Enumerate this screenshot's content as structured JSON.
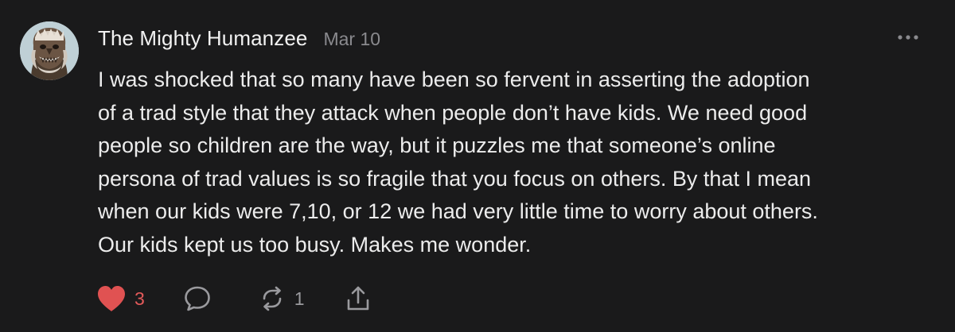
{
  "post": {
    "author": "The Mighty Humanzee",
    "date": "Mar 10",
    "avatar_icon": "humanzee-avatar",
    "more_icon": "more-horizontal-icon",
    "text_lines": [
      "I was shocked that so many have been so fervent in asserting the adoption",
      "of a trad style that they attack when people don’t have kids. We need good",
      "people so children are the way, but it puzzles me that someone’s online",
      "persona of trad values is so fragile that you focus on others. By that I mean",
      "when our kids were 7,10, or 12 we had very little time to worry about others.",
      "Our kids kept us too busy. Makes me wonder."
    ]
  },
  "actions": {
    "like": {
      "icon": "heart-icon",
      "count": "3",
      "color": "#e35a5a",
      "liked": true
    },
    "reply": {
      "icon": "comment-icon"
    },
    "repost": {
      "icon": "repost-icon",
      "count": "1"
    },
    "share": {
      "icon": "share-icon"
    }
  },
  "colors": {
    "background": "#1a1a1b",
    "text": "#ececec",
    "muted": "#8a8a8e",
    "like": "#e35a5a"
  }
}
